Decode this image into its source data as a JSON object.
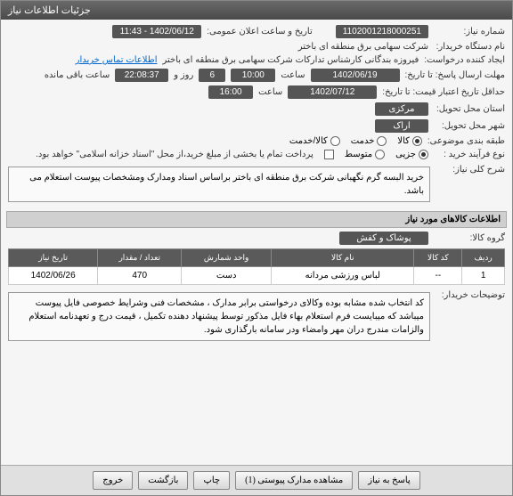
{
  "window_title": "جزئیات اطلاعات نیاز",
  "fields": {
    "need_no_label": "شماره نیاز:",
    "need_no": "1102001218000251",
    "announce_label": "تاریخ و ساعت اعلان عمومی:",
    "announce_value": "1402/06/12 - 11:43",
    "buyer_label": "نام دستگاه خریدار:",
    "buyer_value": "شرکت سهامی برق منطقه ای باختر",
    "creator_label": "ایجاد کننده درخواست:",
    "creator_value": "فیروزه بندگانی کارشناس تدارکات شرکت سهامی برق منطقه ای باختر",
    "contact_link": "اطلاعات تماس خریدار",
    "deadline_label": "مهلت ارسال پاسخ: تا تاریخ:",
    "deadline_date": "1402/06/19",
    "time_label": "ساعت",
    "deadline_time": "10:00",
    "days_label": "روز و",
    "days_value": "6",
    "remain_time": "22:08:37",
    "remain_label": "ساعت باقی مانده",
    "valid_label": "حداقل تاریخ اعتبار قیمت: تا تاریخ:",
    "valid_date": "1402/07/12",
    "valid_time": "16:00",
    "province_label": "استان محل تحویل:",
    "province": "مرکزی",
    "city_label": "شهر محل تحویل:",
    "city": "اراک",
    "category_label": "طبقه بندی موضوعی:",
    "cat_goods": "کالا",
    "cat_service": "خدمت",
    "cat_both": "کالا/خدمت",
    "purchase_type_label": "نوع فرآیند خرید :",
    "pt_minor": "جزیی",
    "pt_medium": "متوسط",
    "payment_note": "پرداخت تمام یا بخشی از مبلغ خرید،از محل \"اسناد خزانه اسلامی\" خواهد بود.",
    "desc_label": "شرح کلی نیاز:",
    "desc_text": "خرید البسه گرم نگهبانی شرکت برق منطقه ای باختر براساس اسناد ومدارک ومشخصات پیوست استعلام می باشد.",
    "goods_header": "اطلاعات کالاهای مورد نیاز",
    "goods_group_label": "گروه کالا:",
    "goods_group": "پوشاک و کفش",
    "buyer_notes_label": "توضیحات خریدار:",
    "buyer_notes": "کد انتخاب شده مشابه بوده وکالای درخواستی برابر مدارک ، مشخصات فنی وشرایط خصوصی فایل پیوست میباشد که میبایست فرم استعلام بهاء فایل مذکور توسط پیشنهاد دهنده تکمیل ، قیمت درج و تعهدنامه استعلام والزامات  مندرج دران مهر وامضاء ودر سامانه بارگذاری شود."
  },
  "table": {
    "headers": [
      "ردیف",
      "کد کالا",
      "نام کالا",
      "واحد شمارش",
      "تعداد / مقدار",
      "تاریخ نیاز"
    ],
    "rows": [
      {
        "idx": "1",
        "code": "--",
        "name": "لباس ورزشی مردانه",
        "unit": "دست",
        "qty": "470",
        "date": "1402/06/26"
      }
    ]
  },
  "buttons": {
    "respond": "پاسخ به نیاز",
    "attachments": "مشاهده مدارک پیوستی (1)",
    "print": "چاپ",
    "back": "بازگشت",
    "exit": "خروج"
  }
}
